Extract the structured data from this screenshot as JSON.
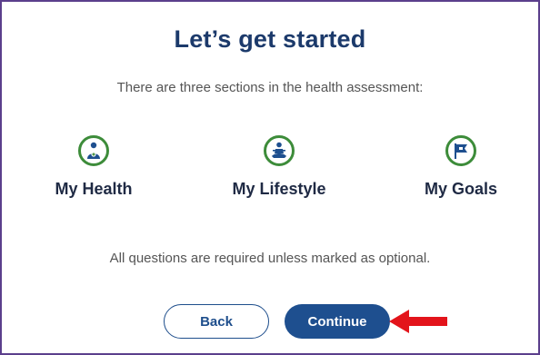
{
  "header": {
    "title": "Let’s get started"
  },
  "intro": {
    "text": "There are three sections in the health assessment:"
  },
  "sections": [
    {
      "label": "My Health",
      "icon": "health-person-icon"
    },
    {
      "label": "My Lifestyle",
      "icon": "lifestyle-meditation-icon"
    },
    {
      "label": "My Goals",
      "icon": "goals-flag-icon"
    }
  ],
  "note": {
    "text": "All questions are required unless marked as optional."
  },
  "buttons": {
    "back_label": "Back",
    "continue_label": "Continue"
  },
  "annotation": {
    "arrow_color": "#e3141b"
  },
  "colors": {
    "accent": "#1e4f8f",
    "icon_ring": "#3d8c3a",
    "frame": "#5b3f8c"
  }
}
